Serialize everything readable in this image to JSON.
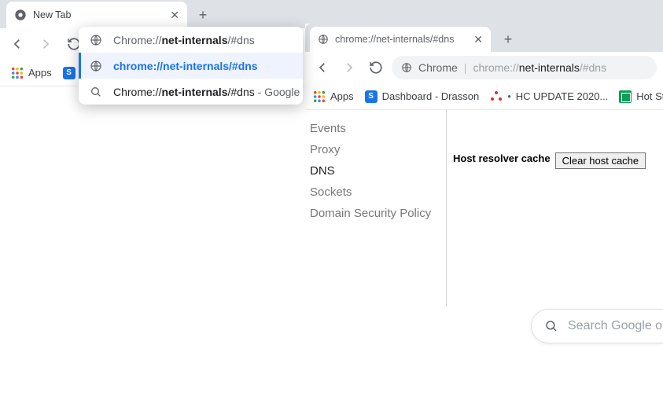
{
  "left_window": {
    "tab_title": "New Tab",
    "bookmarks_bar": {
      "apps_label": "Apps"
    }
  },
  "omnibox": {
    "typed_prefix": "Chrome://",
    "typed_bold": "net-internals",
    "typed_suffix": "/#dns",
    "suggestion_selected": "chrome://net-internals/#dns",
    "suggestion_search_prefix": "Chrome://",
    "suggestion_search_bold": "net-internals",
    "suggestion_search_suffix": "/#dns",
    "suggestion_search_tail": " - Google"
  },
  "right_window": {
    "tab_title": "chrome://net-internals/#dns",
    "omnibox_chip": "Chrome",
    "omnibox_url_gray1": "chrome://",
    "omnibox_url_dark": "net-internals",
    "omnibox_url_gray2": "/#dns",
    "bookmarks": {
      "apps": "Apps",
      "b1": "Dashboard - Drasson",
      "b2": "HC UPDATE 2020...",
      "b3": "Hot Stylin"
    },
    "sidebar": {
      "items": [
        "Events",
        "Proxy",
        "DNS",
        "Sockets",
        "Domain Security Policy"
      ],
      "active_index": 2
    },
    "main": {
      "label": "Host resolver cache",
      "button": "Clear host cache"
    }
  },
  "search_pill": "Search Google o"
}
